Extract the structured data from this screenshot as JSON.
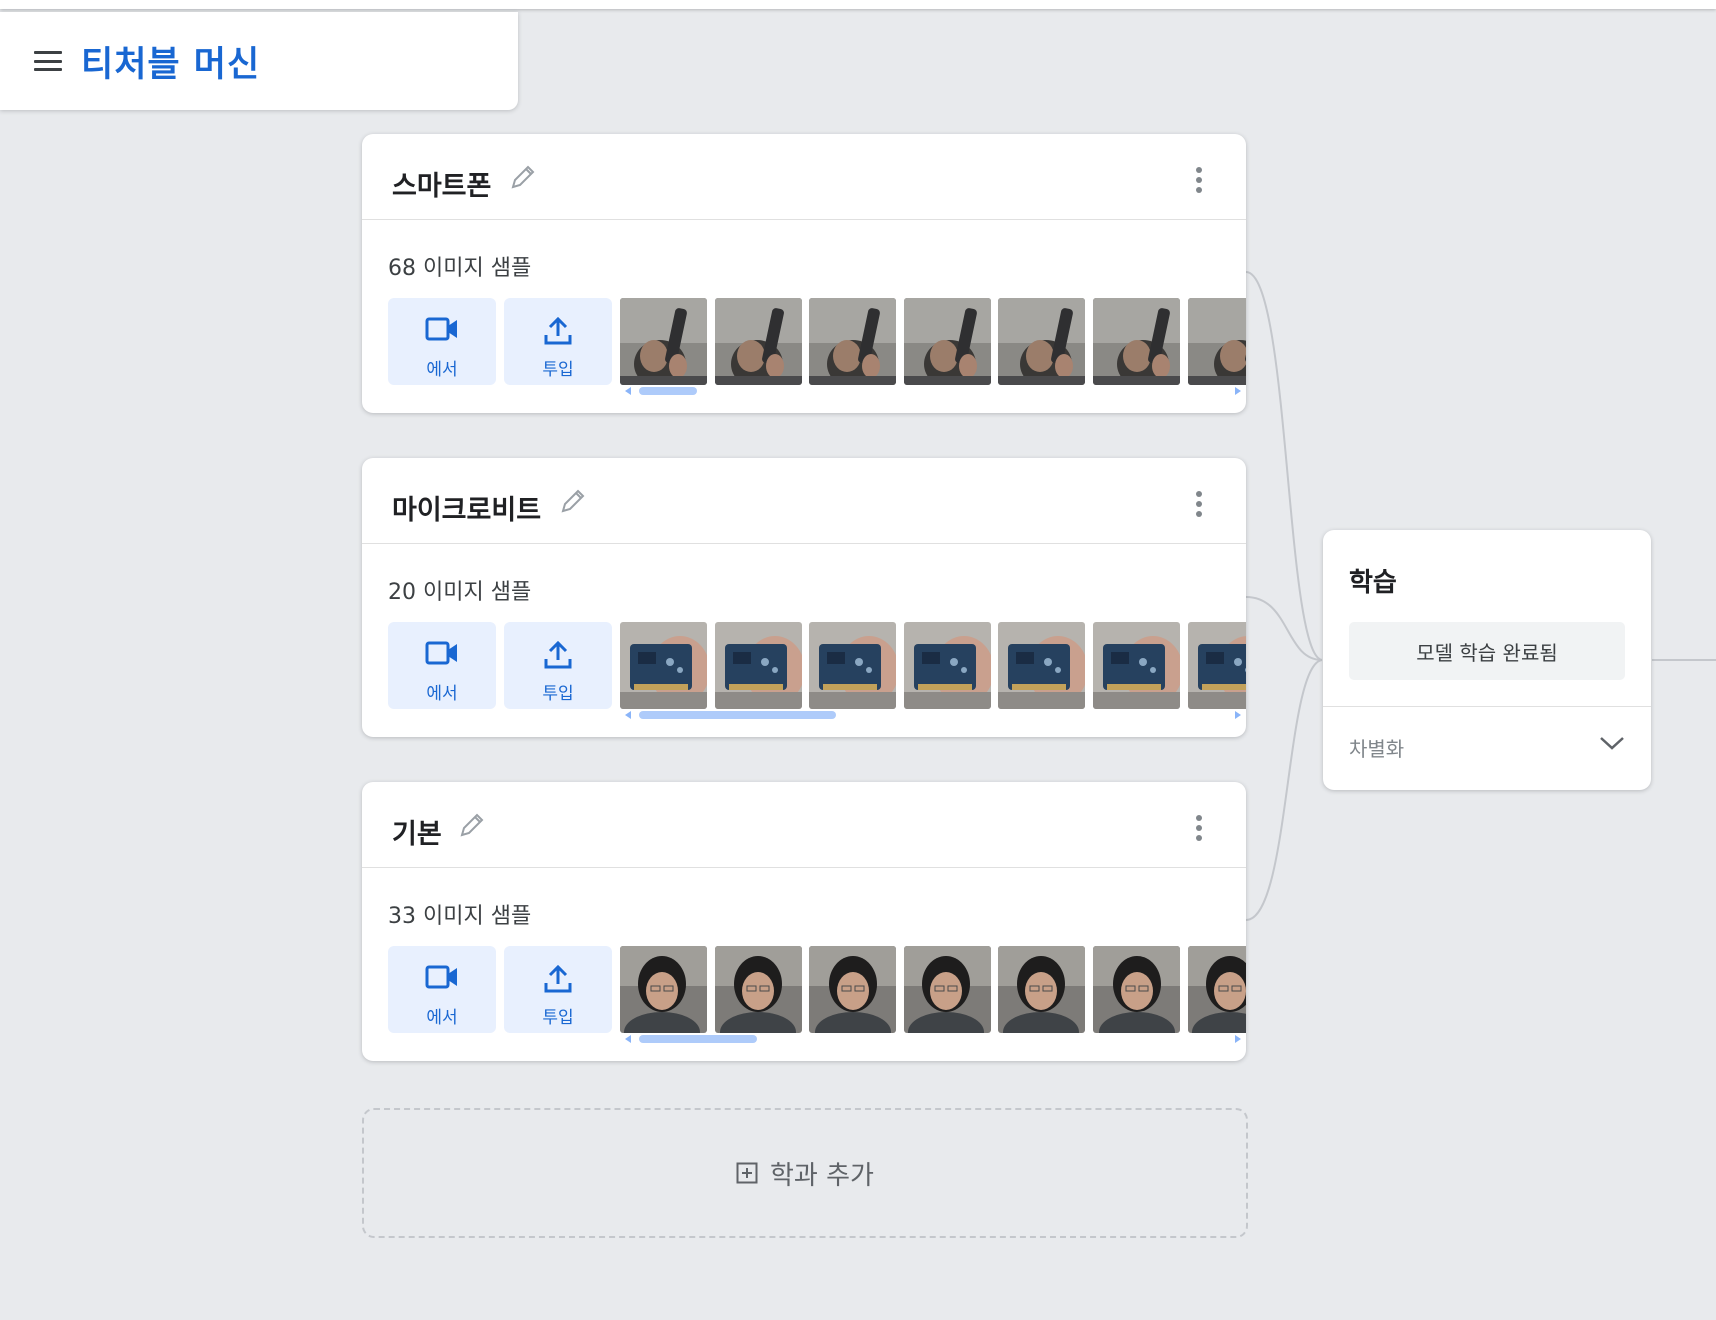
{
  "app": {
    "title": "티처블 머신"
  },
  "classes": [
    {
      "name": "스마트폰",
      "samples": "68 이미지 샘플",
      "webcam_label": "에서",
      "upload_label": "투입",
      "thumb_type": "phone"
    },
    {
      "name": "마이크로비트",
      "samples": "20 이미지 샘플",
      "webcam_label": "에서",
      "upload_label": "투입",
      "thumb_type": "board"
    },
    {
      "name": "기본",
      "samples": "33 이미지 샘플",
      "webcam_label": "에서",
      "upload_label": "투입",
      "thumb_type": "face"
    }
  ],
  "add_class": {
    "label": "학과 추가"
  },
  "training": {
    "title": "학습",
    "button_label": "모델 학습 완료됨",
    "advanced_label": "차별화"
  },
  "colors": {
    "accent": "#1967d2",
    "button_bg": "#e8f0fe",
    "background": "#e8eaed"
  }
}
